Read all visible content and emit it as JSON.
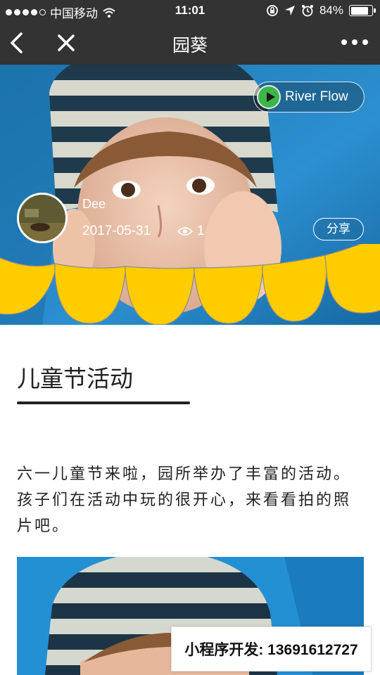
{
  "status_bar": {
    "carrier": "中国移动",
    "time": "11:01",
    "battery_percent": "84%",
    "battery_level": 0.84,
    "signal_bars_filled": 4,
    "signal_bars_total": 5
  },
  "nav": {
    "title": "园葵",
    "icons": [
      "back-arrow-icon",
      "close-icon",
      "more-dots-icon"
    ]
  },
  "hero": {
    "music_title": "River Flow",
    "author": "Dee",
    "date": "2017-05-31",
    "view_count": "1",
    "share_label": "分享",
    "scallop_color": "#ffcc00"
  },
  "article": {
    "title": "儿童节活动",
    "body": "六一儿童节来啦，园所举办了丰富的活动。孩子们在活动中玩的很开心，来看看拍的照片吧。"
  },
  "watermark": {
    "text": "小程序开发: 13691612727"
  }
}
